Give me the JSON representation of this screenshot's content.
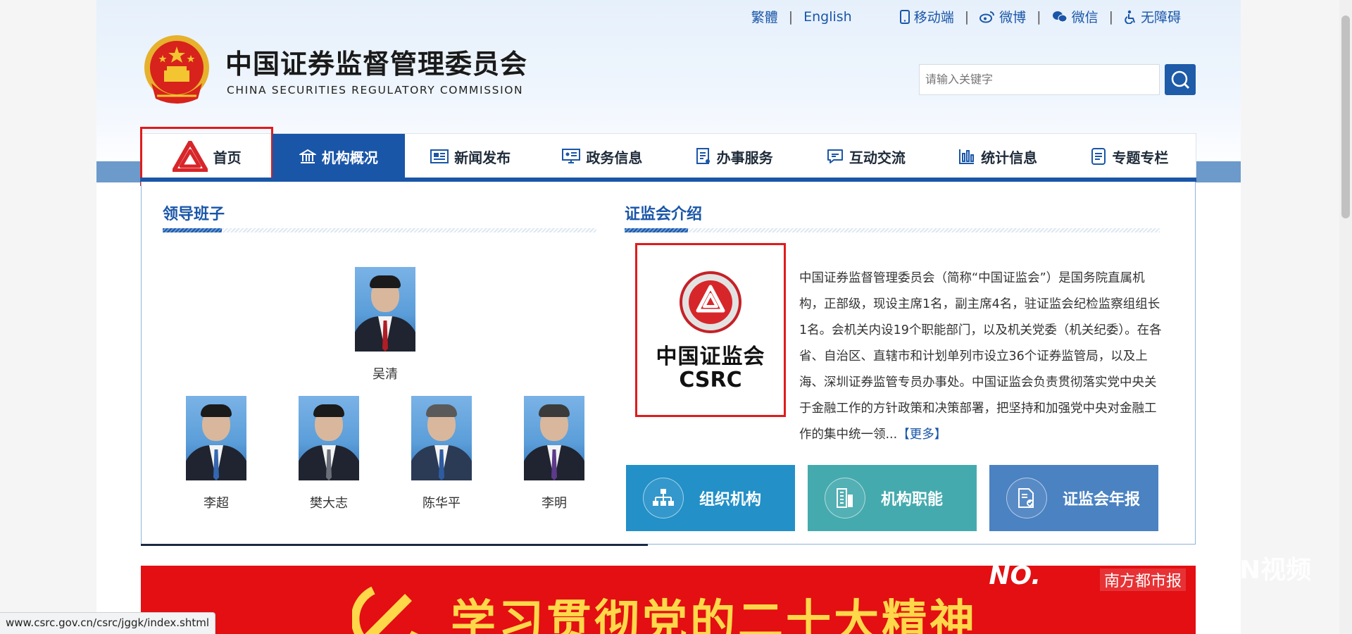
{
  "topbar": {
    "traditional": "繁體",
    "english": "English",
    "mobile": "移动端",
    "weibo": "微博",
    "wechat": "微信",
    "accessibility": "无障碍"
  },
  "brand": {
    "name_cn": "中国证券监督管理委员会",
    "name_en": "CHINA SECURITIES REGULATORY COMMISSION"
  },
  "search": {
    "placeholder": "请输入关键字"
  },
  "nav": {
    "items": [
      {
        "label": "首页",
        "icon": "csrc-logo-icon"
      },
      {
        "label": "机构概况",
        "icon": "institution-building-icon"
      },
      {
        "label": "新闻发布",
        "icon": "news-icon"
      },
      {
        "label": "政务信息",
        "icon": "government-info-icon"
      },
      {
        "label": "办事服务",
        "icon": "service-icon"
      },
      {
        "label": "互动交流",
        "icon": "chat-icon"
      },
      {
        "label": "统计信息",
        "icon": "bar-stats-icon"
      },
      {
        "label": "专题专栏",
        "icon": "topic-document-icon"
      }
    ]
  },
  "leadership": {
    "title": "领导班子",
    "chair": "吴清",
    "members": [
      "李超",
      "樊大志",
      "陈华平",
      "李明"
    ]
  },
  "intro": {
    "title": "证监会介绍",
    "logo_cn": "中国证监会",
    "logo_en": "CSRC",
    "text": "中国证券监督管理委员会（简称“中国证监会”）是国务院直属机构，正部级，现设主席1名，副主席4名，驻证监会纪检监察组组长1名。会机关内设19个职能部门，以及机关党委（机关纪委）。在各省、自治区、直辖市和计划单列市设立36个证券监管局，以及上海、深圳证券监管专员办事处。中国证监会负责贯彻落实党中央关于金融工作的方针政策和决策部署，把坚持和加强党中央对金融工作的集中统一领...",
    "more": "【更多】"
  },
  "quick_links": [
    {
      "label": "组织机构",
      "color": "#2390c8",
      "icon": "org-chart-icon"
    },
    {
      "label": "机构职能",
      "color": "#45aaae",
      "icon": "building-function-icon"
    },
    {
      "label": "证监会年报",
      "color": "#4a82c2",
      "icon": "annual-report-icon"
    }
  ],
  "banner": {
    "title": "学习贯彻党的二十大精神",
    "tag": "NO.",
    "sub": "南方都市报"
  },
  "watermark": "N视频",
  "status_url": "www.csrc.gov.cn/csrc/jggk/index.shtml",
  "colors": {
    "primary_blue": "#1a56a8",
    "highlight_red": "#e11b1b",
    "banner_red": "#e30f12"
  }
}
